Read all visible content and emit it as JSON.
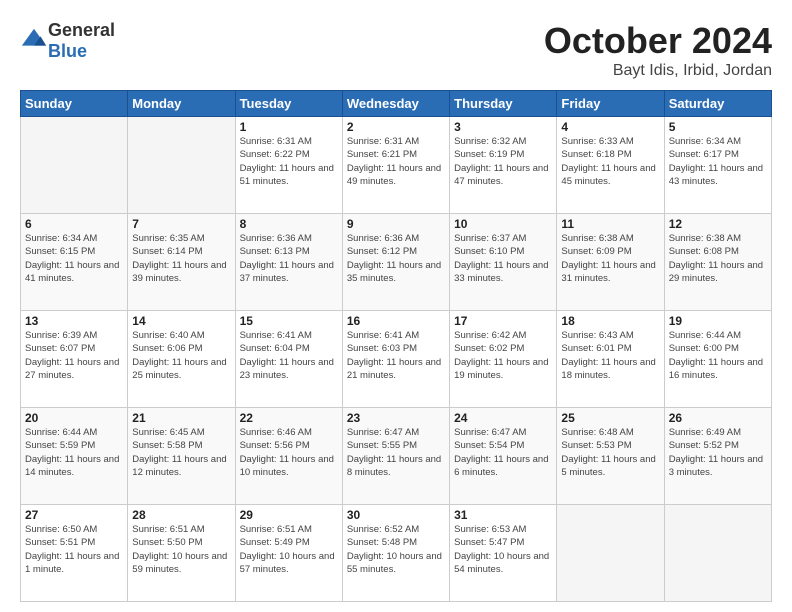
{
  "header": {
    "logo_general": "General",
    "logo_blue": "Blue",
    "title": "October 2024",
    "location": "Bayt Idis, Irbid, Jordan"
  },
  "weekdays": [
    "Sunday",
    "Monday",
    "Tuesday",
    "Wednesday",
    "Thursday",
    "Friday",
    "Saturday"
  ],
  "weeks": [
    [
      {
        "day": "",
        "info": ""
      },
      {
        "day": "",
        "info": ""
      },
      {
        "day": "1",
        "info": "Sunrise: 6:31 AM\nSunset: 6:22 PM\nDaylight: 11 hours and 51 minutes."
      },
      {
        "day": "2",
        "info": "Sunrise: 6:31 AM\nSunset: 6:21 PM\nDaylight: 11 hours and 49 minutes."
      },
      {
        "day": "3",
        "info": "Sunrise: 6:32 AM\nSunset: 6:19 PM\nDaylight: 11 hours and 47 minutes."
      },
      {
        "day": "4",
        "info": "Sunrise: 6:33 AM\nSunset: 6:18 PM\nDaylight: 11 hours and 45 minutes."
      },
      {
        "day": "5",
        "info": "Sunrise: 6:34 AM\nSunset: 6:17 PM\nDaylight: 11 hours and 43 minutes."
      }
    ],
    [
      {
        "day": "6",
        "info": "Sunrise: 6:34 AM\nSunset: 6:15 PM\nDaylight: 11 hours and 41 minutes."
      },
      {
        "day": "7",
        "info": "Sunrise: 6:35 AM\nSunset: 6:14 PM\nDaylight: 11 hours and 39 minutes."
      },
      {
        "day": "8",
        "info": "Sunrise: 6:36 AM\nSunset: 6:13 PM\nDaylight: 11 hours and 37 minutes."
      },
      {
        "day": "9",
        "info": "Sunrise: 6:36 AM\nSunset: 6:12 PM\nDaylight: 11 hours and 35 minutes."
      },
      {
        "day": "10",
        "info": "Sunrise: 6:37 AM\nSunset: 6:10 PM\nDaylight: 11 hours and 33 minutes."
      },
      {
        "day": "11",
        "info": "Sunrise: 6:38 AM\nSunset: 6:09 PM\nDaylight: 11 hours and 31 minutes."
      },
      {
        "day": "12",
        "info": "Sunrise: 6:38 AM\nSunset: 6:08 PM\nDaylight: 11 hours and 29 minutes."
      }
    ],
    [
      {
        "day": "13",
        "info": "Sunrise: 6:39 AM\nSunset: 6:07 PM\nDaylight: 11 hours and 27 minutes."
      },
      {
        "day": "14",
        "info": "Sunrise: 6:40 AM\nSunset: 6:06 PM\nDaylight: 11 hours and 25 minutes."
      },
      {
        "day": "15",
        "info": "Sunrise: 6:41 AM\nSunset: 6:04 PM\nDaylight: 11 hours and 23 minutes."
      },
      {
        "day": "16",
        "info": "Sunrise: 6:41 AM\nSunset: 6:03 PM\nDaylight: 11 hours and 21 minutes."
      },
      {
        "day": "17",
        "info": "Sunrise: 6:42 AM\nSunset: 6:02 PM\nDaylight: 11 hours and 19 minutes."
      },
      {
        "day": "18",
        "info": "Sunrise: 6:43 AM\nSunset: 6:01 PM\nDaylight: 11 hours and 18 minutes."
      },
      {
        "day": "19",
        "info": "Sunrise: 6:44 AM\nSunset: 6:00 PM\nDaylight: 11 hours and 16 minutes."
      }
    ],
    [
      {
        "day": "20",
        "info": "Sunrise: 6:44 AM\nSunset: 5:59 PM\nDaylight: 11 hours and 14 minutes."
      },
      {
        "day": "21",
        "info": "Sunrise: 6:45 AM\nSunset: 5:58 PM\nDaylight: 11 hours and 12 minutes."
      },
      {
        "day": "22",
        "info": "Sunrise: 6:46 AM\nSunset: 5:56 PM\nDaylight: 11 hours and 10 minutes."
      },
      {
        "day": "23",
        "info": "Sunrise: 6:47 AM\nSunset: 5:55 PM\nDaylight: 11 hours and 8 minutes."
      },
      {
        "day": "24",
        "info": "Sunrise: 6:47 AM\nSunset: 5:54 PM\nDaylight: 11 hours and 6 minutes."
      },
      {
        "day": "25",
        "info": "Sunrise: 6:48 AM\nSunset: 5:53 PM\nDaylight: 11 hours and 5 minutes."
      },
      {
        "day": "26",
        "info": "Sunrise: 6:49 AM\nSunset: 5:52 PM\nDaylight: 11 hours and 3 minutes."
      }
    ],
    [
      {
        "day": "27",
        "info": "Sunrise: 6:50 AM\nSunset: 5:51 PM\nDaylight: 11 hours and 1 minute."
      },
      {
        "day": "28",
        "info": "Sunrise: 6:51 AM\nSunset: 5:50 PM\nDaylight: 10 hours and 59 minutes."
      },
      {
        "day": "29",
        "info": "Sunrise: 6:51 AM\nSunset: 5:49 PM\nDaylight: 10 hours and 57 minutes."
      },
      {
        "day": "30",
        "info": "Sunrise: 6:52 AM\nSunset: 5:48 PM\nDaylight: 10 hours and 55 minutes."
      },
      {
        "day": "31",
        "info": "Sunrise: 6:53 AM\nSunset: 5:47 PM\nDaylight: 10 hours and 54 minutes."
      },
      {
        "day": "",
        "info": ""
      },
      {
        "day": "",
        "info": ""
      }
    ]
  ]
}
